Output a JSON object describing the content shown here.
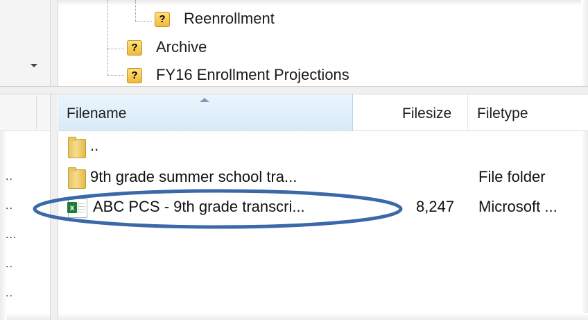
{
  "tree": {
    "items": [
      {
        "label": "Reenrollment",
        "icon": "question-folder-icon"
      },
      {
        "label": "Archive",
        "icon": "question-folder-icon"
      },
      {
        "label": "FY16 Enrollment Projections",
        "icon": "question-folder-icon"
      }
    ]
  },
  "file_list": {
    "columns": {
      "filename": "Filename",
      "filesize": "Filesize",
      "filetype": "Filetype"
    },
    "rows": [
      {
        "name": "..",
        "size": "",
        "type": "",
        "icon": "folder-icon"
      },
      {
        "name": "9th grade summer school tra...",
        "size": "",
        "type": "File folder",
        "icon": "folder-icon"
      },
      {
        "name": "ABC PCS - 9th grade transcri...",
        "size": "8,247",
        "type": "Microsoft ...",
        "icon": "excel-file-icon"
      }
    ]
  },
  "left_pane": {
    "truncated_rows": [
      "..",
      "..",
      "...",
      "..",
      ".."
    ]
  },
  "annotation": {
    "color": "#3a68a8"
  }
}
